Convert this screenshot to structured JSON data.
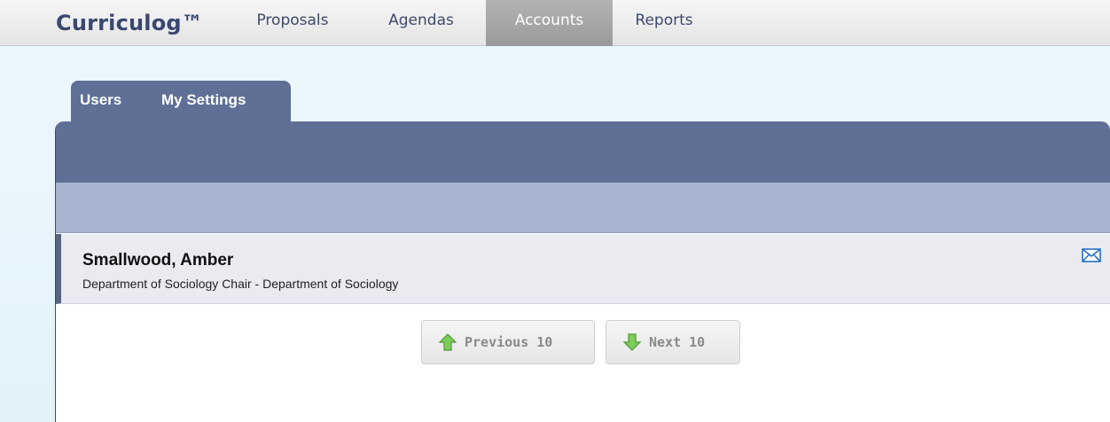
{
  "header": {
    "brand": "Curriculog™",
    "nav": [
      "Proposals",
      "Agendas",
      "Accounts",
      "Reports"
    ],
    "active_nav": "Accounts"
  },
  "tabs": {
    "users": "Users",
    "settings": "My Settings"
  },
  "user": {
    "name": "Smallwood, Amber",
    "department": "Department of Sociology Chair - Department of Sociology"
  },
  "pager": {
    "previous": "Previous 10",
    "next": "Next 10"
  },
  "icons": {
    "mail": "envelope-icon",
    "previous": "arrow-up-icon",
    "next": "arrow-down-icon"
  },
  "colors": {
    "brand": "#3a4770",
    "panel_header": "#5f6f96",
    "panel_sub": "#a9b4d1",
    "arrow": "#6cc24a"
  }
}
